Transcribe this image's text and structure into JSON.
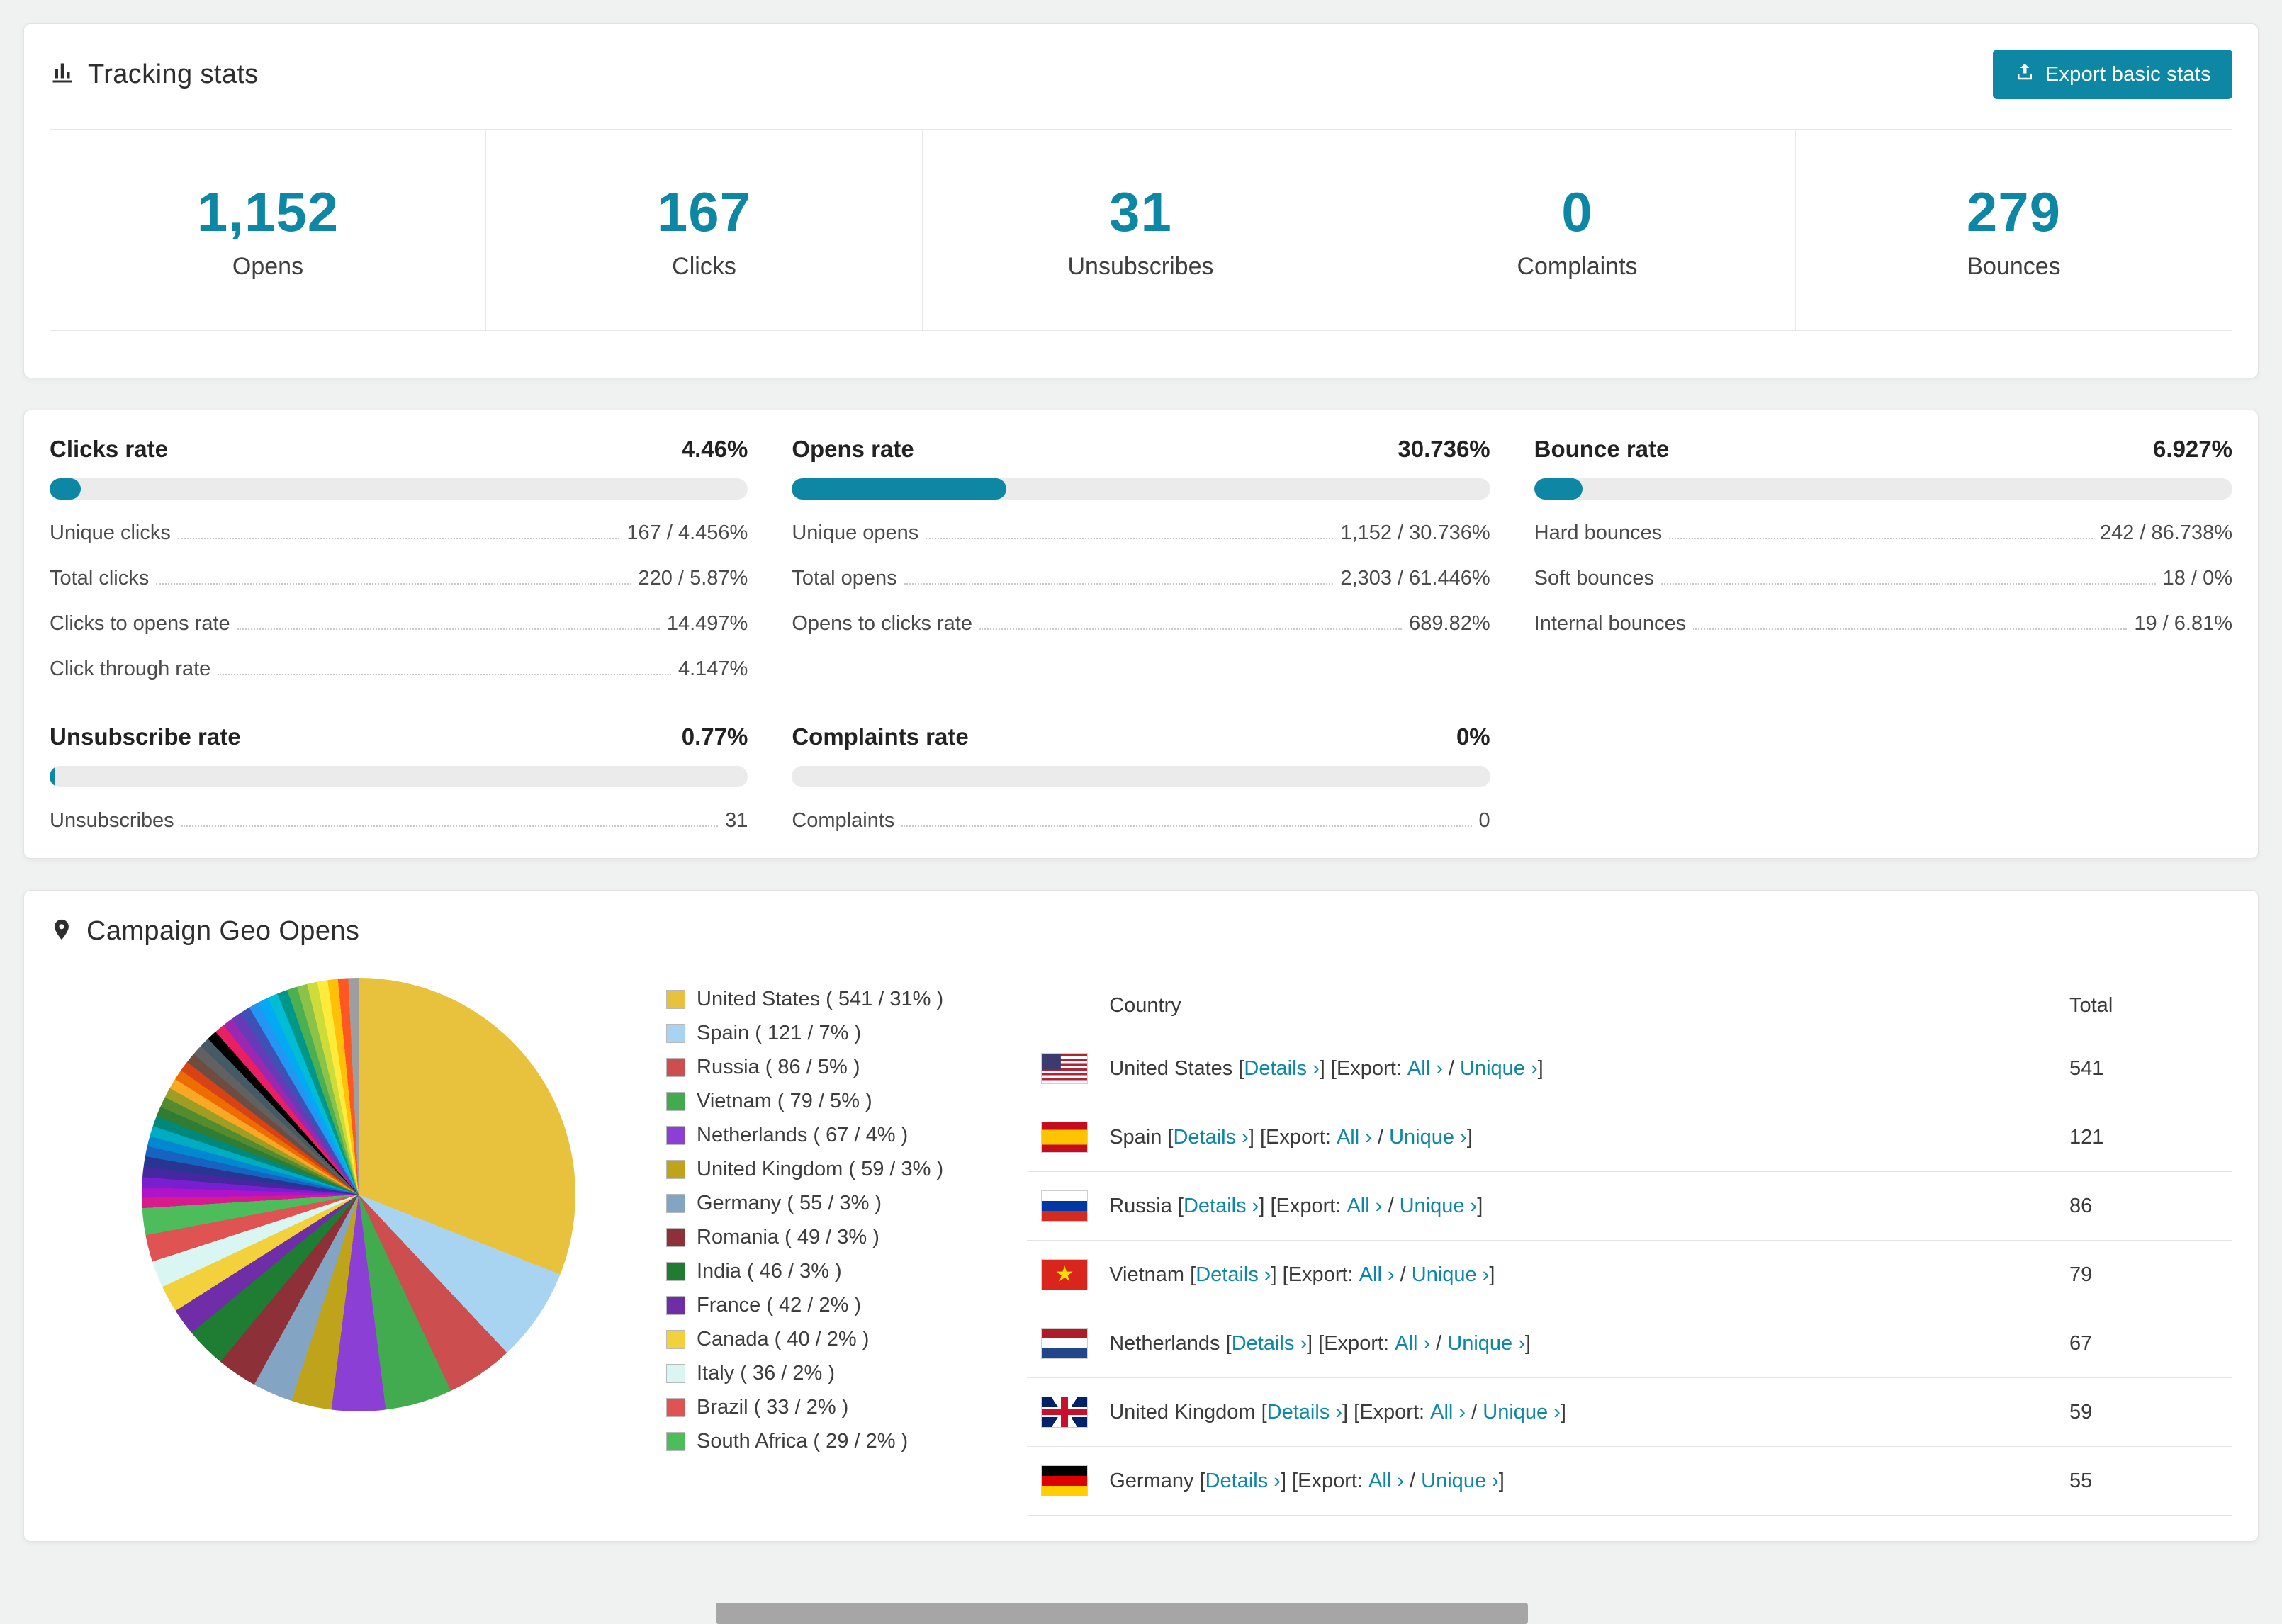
{
  "theme": {
    "accent": "#0e87a5",
    "page_background": "#f0f1f1",
    "bar_track": "#ebebeb"
  },
  "tracking": {
    "title": "Tracking stats",
    "export_button": "Export basic stats",
    "stats": [
      {
        "value": "1,152",
        "label": "Opens"
      },
      {
        "value": "167",
        "label": "Clicks"
      },
      {
        "value": "31",
        "label": "Unsubscribes"
      },
      {
        "value": "0",
        "label": "Complaints"
      },
      {
        "value": "279",
        "label": "Bounces"
      }
    ]
  },
  "rates": [
    {
      "label": "Clicks rate",
      "value": "4.46%",
      "percent": 4.46,
      "rows": [
        {
          "label": "Unique clicks",
          "value": "167 / 4.456%"
        },
        {
          "label": "Total clicks",
          "value": "220 / 5.87%"
        },
        {
          "label": "Clicks to opens rate",
          "value": "14.497%"
        },
        {
          "label": "Click through rate",
          "value": "4.147%"
        }
      ]
    },
    {
      "label": "Opens rate",
      "value": "30.736%",
      "percent": 30.736,
      "rows": [
        {
          "label": "Unique opens",
          "value": "1,152 / 30.736%"
        },
        {
          "label": "Total opens",
          "value": "2,303 / 61.446%"
        },
        {
          "label": "Opens to clicks rate",
          "value": "689.82%"
        }
      ]
    },
    {
      "label": "Bounce rate",
      "value": "6.927%",
      "percent": 6.927,
      "rows": [
        {
          "label": "Hard bounces",
          "value": "242 / 86.738%"
        },
        {
          "label": "Soft bounces",
          "value": "18 / 0%"
        },
        {
          "label": "Internal bounces",
          "value": "19 / 6.81%"
        }
      ]
    },
    {
      "label": "Unsubscribe rate",
      "value": "0.77%",
      "percent": 0.77,
      "rows": [
        {
          "label": "Unsubscribes",
          "value": "31"
        }
      ]
    },
    {
      "label": "Complaints rate",
      "value": "0%",
      "percent": 0,
      "rows": [
        {
          "label": "Complaints",
          "value": "0"
        }
      ]
    }
  ],
  "geo": {
    "title": "Campaign Geo Opens",
    "chart_data": {
      "type": "pie",
      "title": "Campaign Geo Opens",
      "legend_position": "right",
      "slices": [
        {
          "label": "United States",
          "value": 541,
          "percent": 31,
          "color": "#e8c13d"
        },
        {
          "label": "Spain",
          "value": 121,
          "percent": 7,
          "color": "#a8d4f2"
        },
        {
          "label": "Russia",
          "value": 86,
          "percent": 5,
          "color": "#cc4e4e"
        },
        {
          "label": "Vietnam",
          "value": 79,
          "percent": 5,
          "color": "#42ab50"
        },
        {
          "label": "Netherlands",
          "value": 67,
          "percent": 4,
          "color": "#8b3fd4"
        },
        {
          "label": "United Kingdom",
          "value": 59,
          "percent": 3,
          "color": "#bfa31b"
        },
        {
          "label": "Germany",
          "value": 55,
          "percent": 3,
          "color": "#84a4c4"
        },
        {
          "label": "Romania",
          "value": 49,
          "percent": 3,
          "color": "#8e3038"
        },
        {
          "label": "India",
          "value": 46,
          "percent": 3,
          "color": "#1e7d33"
        },
        {
          "label": "France",
          "value": 42,
          "percent": 2,
          "color": "#6f2da8"
        },
        {
          "label": "Canada",
          "value": 40,
          "percent": 2,
          "color": "#f2d13c"
        },
        {
          "label": "Italy",
          "value": 36,
          "percent": 2,
          "color": "#daf6f2"
        },
        {
          "label": "Brazil",
          "value": 33,
          "percent": 2,
          "color": "#e05353"
        },
        {
          "label": "South Africa",
          "value": 29,
          "percent": 2,
          "color": "#4dbd5c"
        }
      ],
      "other_slice_colors": [
        "#d81b8c",
        "#b014c9",
        "#7a1fd0",
        "#4527a0",
        "#283593",
        "#1565c0",
        "#0288d1",
        "#00acc1",
        "#00897b",
        "#2e7d32",
        "#558b2f",
        "#9e9d24",
        "#f9a825",
        "#ef6c00",
        "#d84315",
        "#6d4c41",
        "#616161",
        "#455a64",
        "#000000",
        "#e91e63",
        "#9c27b0",
        "#673ab7",
        "#3f51b5",
        "#2196f3",
        "#03a9f4",
        "#00bcd4",
        "#009688",
        "#4caf50",
        "#8bc34a",
        "#cddc39",
        "#ffeb3b",
        "#ffc107",
        "#ff5722",
        "#9e9e9e"
      ]
    },
    "table": {
      "country_header": "Country",
      "total_header": "Total",
      "details_label": "Details ›",
      "export_label": "Export:",
      "all_label": "All ›",
      "unique_label": "Unique ›",
      "rows": [
        {
          "flag": "us",
          "country": "United States",
          "total": "541"
        },
        {
          "flag": "es",
          "country": "Spain",
          "total": "121"
        },
        {
          "flag": "ru",
          "country": "Russia",
          "total": "86"
        },
        {
          "flag": "vn",
          "country": "Vietnam",
          "total": "79"
        },
        {
          "flag": "nl",
          "country": "Netherlands",
          "total": "67"
        },
        {
          "flag": "gb",
          "country": "United Kingdom",
          "total": "59"
        },
        {
          "flag": "de",
          "country": "Germany",
          "total": "55"
        }
      ]
    }
  }
}
